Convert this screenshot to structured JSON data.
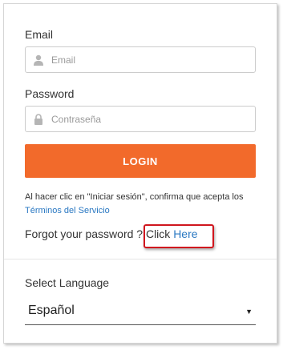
{
  "form": {
    "email_label": "Email",
    "email_placeholder": "Email",
    "email_icon": "user-icon",
    "password_label": "Password",
    "password_placeholder": "Contraseña",
    "password_icon": "lock-icon",
    "login_button": "LOGIN",
    "terms_text": "Al hacer clic en \"Iniciar sesión\", confirma que acepta los ",
    "terms_link": "Términos del Servicio",
    "forgot_text": "Forgot your password ? Click ",
    "forgot_link": "Here"
  },
  "language": {
    "label": "Select Language",
    "selected": "Español"
  },
  "colors": {
    "accent": "#f26a2b",
    "link": "#2a78c2",
    "highlight": "#d0161e"
  }
}
